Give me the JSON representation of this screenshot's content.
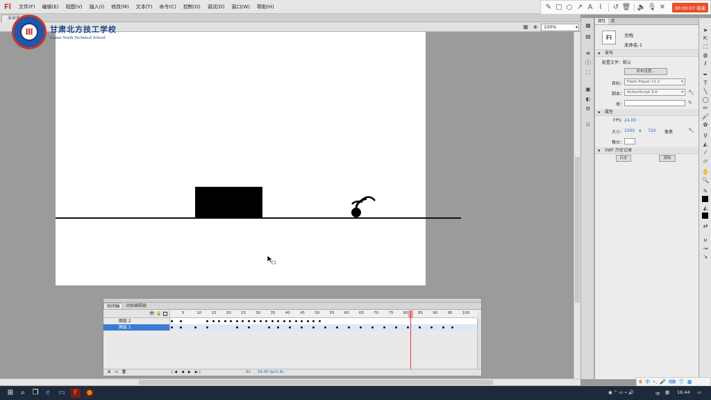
{
  "app": {
    "logo": "Fl",
    "menu": [
      "文件(F)",
      "编辑(E)",
      "视图(V)",
      "插入(I)",
      "修改(M)",
      "文本(T)",
      "命令(C)",
      "控制(O)",
      "调试(D)",
      "窗口(W)",
      "帮助(H)"
    ]
  },
  "recorder": {
    "time_label": "00:00:07 结束",
    "accent": "#e8502c"
  },
  "document_tab": "未命名-1",
  "zoom": "100%",
  "school": {
    "name_cn": "甘肃北方技工学校",
    "name_en": "Gansu North Technical School"
  },
  "timeline": {
    "tabs": [
      "时间轴",
      "动画编辑器"
    ],
    "ruler": [
      "5",
      "10",
      "15",
      "20",
      "25",
      "30",
      "35",
      "40",
      "45",
      "50",
      "55",
      "60",
      "65",
      "70",
      "75",
      "80",
      "85",
      "90",
      "95",
      "100"
    ],
    "layers": [
      {
        "name": "图层 2",
        "selected": false
      },
      {
        "name": "图层 1",
        "selected": true
      }
    ],
    "current_frame": "82",
    "fps": "24.00 fps",
    "time": "3.4s",
    "playhead_color": "#dd3333"
  },
  "properties": {
    "tabs": [
      "属性",
      "库"
    ],
    "doc_type": "文档",
    "doc_name": "未命名-1",
    "publish_section": "发布",
    "profile_label": "配置文件：默认",
    "publish_settings_button": "发布设置...",
    "target_label": "目标：",
    "target_value": "Flash Player 11.2",
    "script_label": "脚本：",
    "script_value": "ActionScript 3.0",
    "class_label": "类：",
    "props_section": "属性",
    "fps_label": "FPS:",
    "fps_value": "24.00",
    "size_label": "大小：",
    "width": "1000",
    "x": "x",
    "height": "720",
    "unit": "像素",
    "stage_label": "舞台：",
    "swf_section": "SWF 历史记录",
    "log_button": "日志",
    "clear_button": "清除"
  },
  "taskbar": {
    "clock": "16:44",
    "lang": "中",
    "ime_items": [
      "S",
      "中",
      "•,",
      "🎤",
      "⌨",
      "👕",
      "▦"
    ]
  }
}
